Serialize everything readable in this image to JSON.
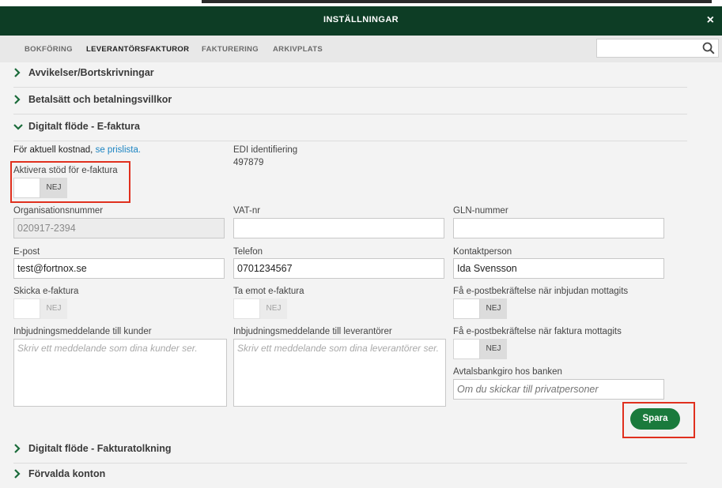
{
  "header": {
    "title": "INSTÄLLNINGAR",
    "close_glyph": "×"
  },
  "tabs": [
    {
      "label": "BOKFÖRING"
    },
    {
      "label": "LEVERANTÖRSFAKTUROR"
    },
    {
      "label": "FAKTURERING"
    },
    {
      "label": "ARKIVPLATS"
    }
  ],
  "active_tab": "LEVERANTÖRSFAKTUROR",
  "search": {
    "value": "",
    "placeholder": ""
  },
  "sections": {
    "avvikelser": "Avvikelser/Bortskrivningar",
    "betalsatt": "Betalsätt och betalningsvillkor",
    "digitalt_efaktura": "Digitalt flöde - E-faktura",
    "digitalt_fakturatolkning": "Digitalt flöde - Fakturatolkning",
    "forvalda_konton": "Förvalda konton"
  },
  "efaktura": {
    "cost_text": "För aktuell kostnad, ",
    "cost_link": "se prislista.",
    "edi_label": "EDI identifiering",
    "edi_value": "497879",
    "activate_label": "Aktivera stöd för e-faktura",
    "activate_state": "NEJ",
    "org_label": "Organisationsnummer",
    "org_value": "020917-2394",
    "vat_label": "VAT-nr",
    "vat_value": "",
    "gln_label": "GLN-nummer",
    "gln_value": "",
    "epost_label": "E-post",
    "epost_value": "test@fortnox.se",
    "telefon_label": "Telefon",
    "telefon_value": "0701234567",
    "kontakt_label": "Kontaktperson",
    "kontakt_value": "Ida Svensson",
    "skicka_label": "Skicka e-faktura",
    "skicka_state": "NEJ",
    "taemot_label": "Ta emot e-faktura",
    "taemot_state": "NEJ",
    "inbjudan_kvitto_label": "Få e-postbekräftelse när inbjudan mottagits",
    "inbjudan_kvitto_state": "NEJ",
    "inbjud_kunder_label": "Inbjudningsmeddelande till kunder",
    "inbjud_kunder_placeholder": "Skriv ett meddelande som dina kunder ser.",
    "inbjud_lev_label": "Inbjudningsmeddelande till leverantörer",
    "inbjud_lev_placeholder": "Skriv ett meddelande som dina leverantörer ser.",
    "faktura_kvitto_label": "Få e-postbekräftelse när faktura mottagits",
    "faktura_kvitto_state": "NEJ",
    "avtal_label": "Avtalsbankgiro hos banken",
    "avtal_placeholder": "Om du skickar till privatpersoner",
    "save_label": "Spara"
  },
  "colors": {
    "header_bg": "#0d3d25",
    "save_bg": "#1a7a3c",
    "highlight": "#e0301e",
    "link": "#1b84c2"
  },
  "icons": {
    "close": "close-icon",
    "search": "search-icon",
    "section_chevron": "chevron-icon"
  }
}
